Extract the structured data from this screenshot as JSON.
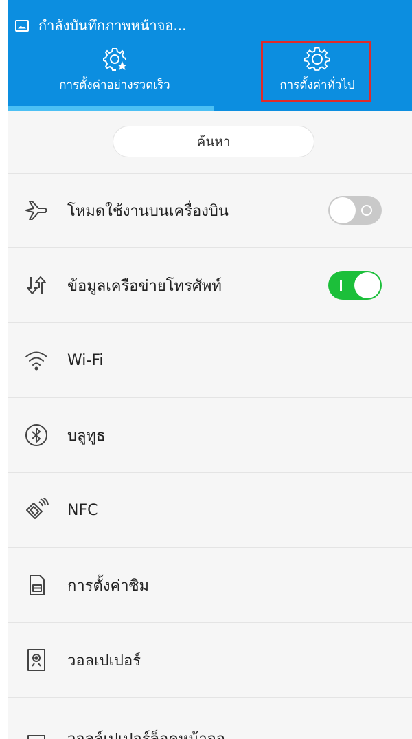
{
  "status_bar": {
    "text": "กำลังบันทึกภาพหน้าจอ...",
    "icon": "image-icon"
  },
  "tabs": [
    {
      "label": "การตั้งค่าอย่างรวดเร็ว",
      "icon": "gear-star-icon",
      "selected": true
    },
    {
      "label": "การตั้งค่าทั่วไป",
      "icon": "gear-icon",
      "selected": false,
      "highlighted": true
    }
  ],
  "search": {
    "placeholder": "ค้นหา"
  },
  "settings": [
    {
      "label": "โหมดใช้งานบนเครื่องบิน",
      "icon": "airplane-icon",
      "toggle": "off"
    },
    {
      "label": "ข้อมูลเครือข่ายโทรศัพท์",
      "icon": "mobile-data-icon",
      "toggle": "on"
    },
    {
      "label": "Wi-Fi",
      "icon": "wifi-icon"
    },
    {
      "label": "บลูทูธ",
      "icon": "bluetooth-icon"
    },
    {
      "label": "NFC",
      "icon": "nfc-icon"
    },
    {
      "label": "การตั้งค่าซิม",
      "icon": "sim-icon"
    },
    {
      "label": "วอลเปเปอร์",
      "icon": "wallpaper-icon"
    },
    {
      "label": "วอลล์เปเปอร์ล็อคหน้าจอ",
      "icon": "lockscreen-wallpaper-icon"
    }
  ],
  "colors": {
    "header": "#0c8ee0",
    "tab_indicator": "#4cc0f4",
    "highlight_box": "#e02a2a",
    "toggle_on": "#1cbf3a",
    "toggle_off": "#c9c9c9"
  }
}
